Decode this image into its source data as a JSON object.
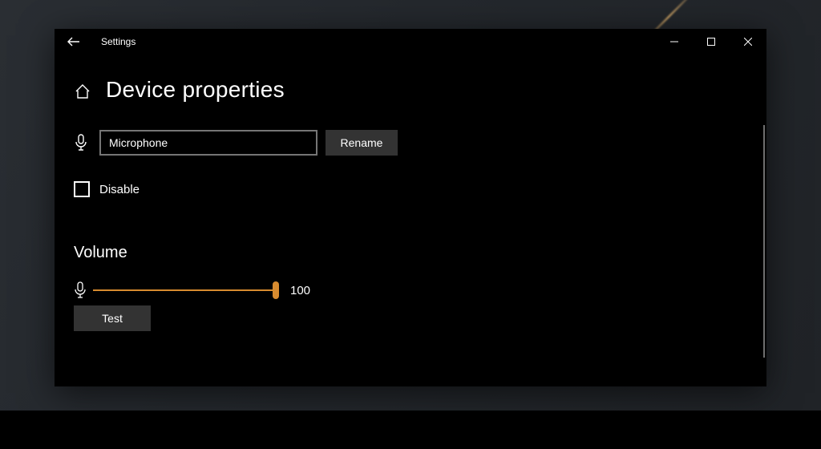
{
  "window": {
    "app_title": "Settings"
  },
  "page": {
    "title": "Device properties"
  },
  "device": {
    "name": "Microphone",
    "rename_label": "Rename",
    "disable_label": "Disable",
    "disable_checked": false
  },
  "volume": {
    "section_label": "Volume",
    "value": "100",
    "percent": 100,
    "test_label": "Test"
  },
  "colors": {
    "accent": "#d78b2f",
    "button_bg": "#333333",
    "input_border": "#757575"
  }
}
